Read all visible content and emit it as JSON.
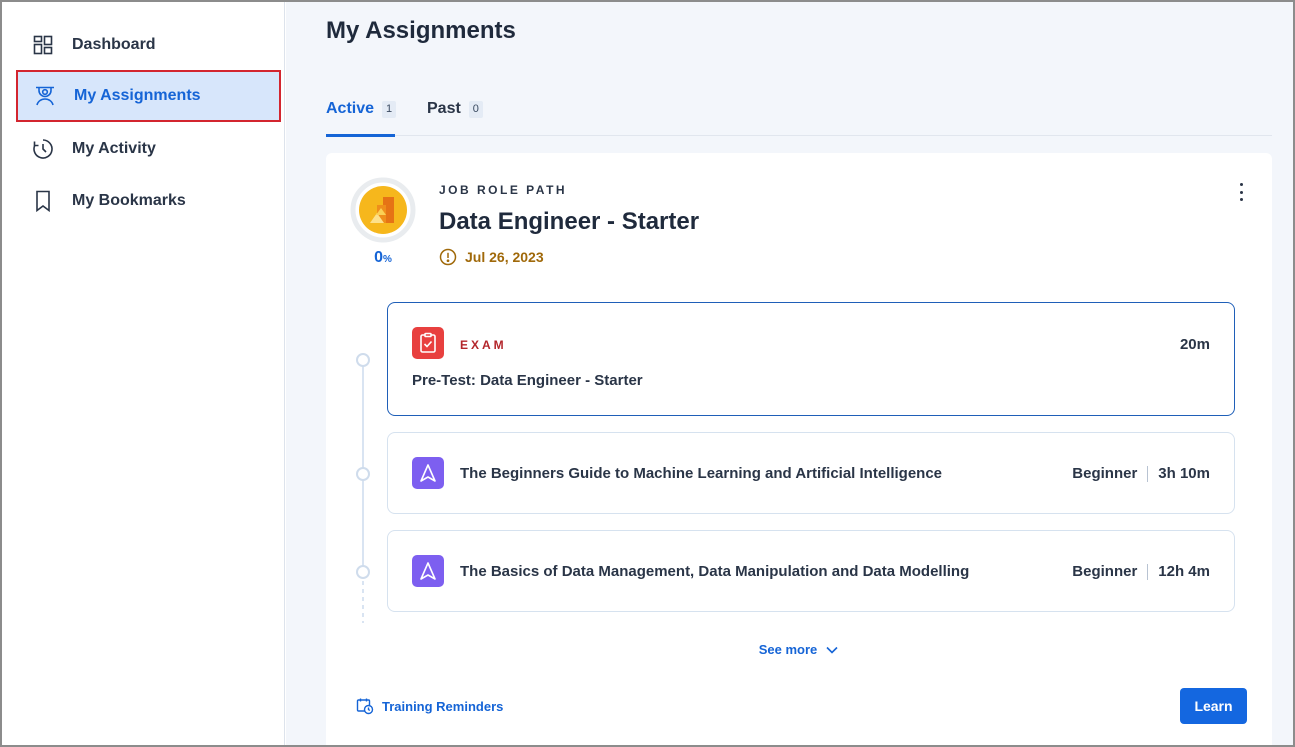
{
  "sidebar": {
    "items": [
      {
        "label": "Dashboard",
        "icon": "dashboard-icon"
      },
      {
        "label": "My Assignments",
        "icon": "assignments-icon",
        "active": true
      },
      {
        "label": "My Activity",
        "icon": "activity-icon"
      },
      {
        "label": "My Bookmarks",
        "icon": "bookmark-icon"
      }
    ]
  },
  "main": {
    "title": "My Assignments",
    "tabs": [
      {
        "label": "Active",
        "count": "1",
        "active": true
      },
      {
        "label": "Past",
        "count": "0"
      }
    ]
  },
  "assignment": {
    "eyebrow": "JOB ROLE PATH",
    "title": "Data Engineer - Starter",
    "progress_value": "0",
    "progress_unit": "%",
    "due_date": "Jul 26, 2023",
    "exam": {
      "type_label": "EXAM",
      "name": "Pre-Test: Data Engineer - Starter",
      "duration": "20m"
    },
    "courses": [
      {
        "name": "The Beginners Guide to Machine Learning and Artificial Intelligence",
        "level": "Beginner",
        "duration": "3h 10m"
      },
      {
        "name": "The Basics of Data Management, Data Manipulation and Data Modelling",
        "level": "Beginner",
        "duration": "12h 4m"
      }
    ],
    "see_more": "See more",
    "reminders": "Training Reminders",
    "learn_button": "Learn"
  },
  "colors": {
    "accent": "#1564d6",
    "due": "#a0690a",
    "exam": "#e8403f",
    "course": "#7d5ff0",
    "highlight_outline": "#d3252f"
  }
}
